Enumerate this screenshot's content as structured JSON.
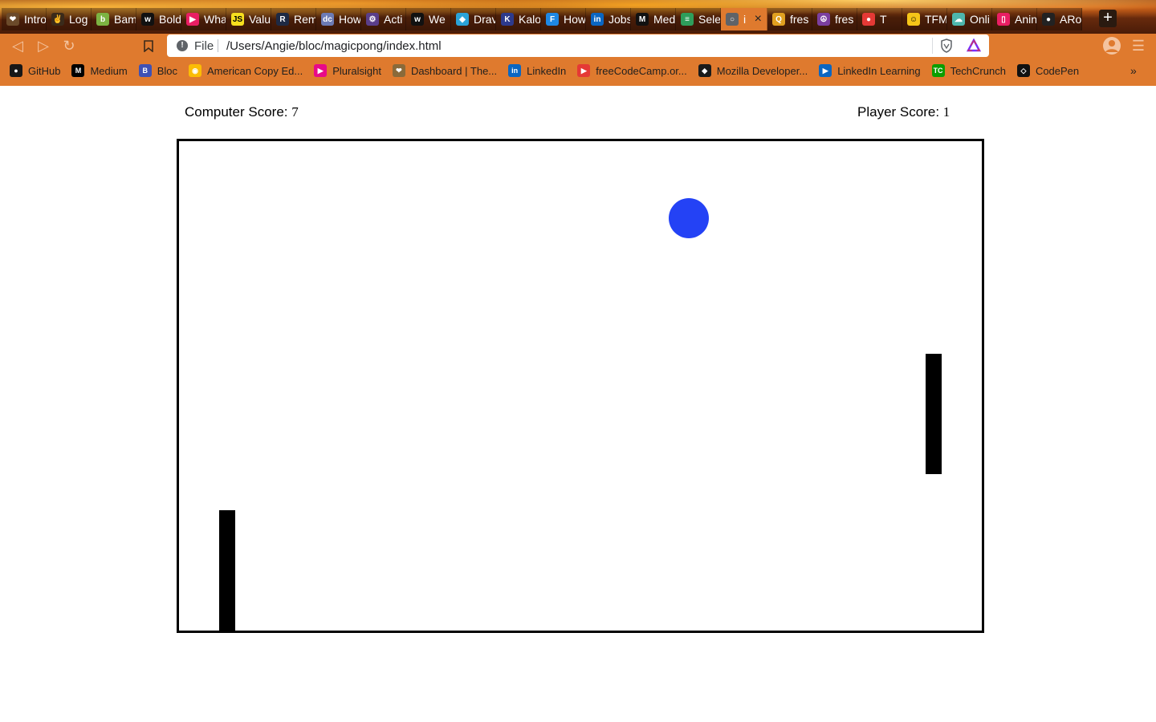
{
  "browser": {
    "tabs": [
      {
        "title": "Intro",
        "color": "#6b4a2a",
        "glyph": "❤"
      },
      {
        "title": "Log",
        "color": "#3a2a1a",
        "glyph": "✌"
      },
      {
        "title": "Bam",
        "color": "#7cb342",
        "glyph": "b"
      },
      {
        "title": "Bold",
        "color": "#111111",
        "glyph": "w"
      },
      {
        "title": "Wha",
        "color": "#e91e63",
        "glyph": "▶"
      },
      {
        "title": "Valu",
        "color": "#f7df1e",
        "glyph": "JS"
      },
      {
        "title": "Rem",
        "color": "#1e2a44",
        "glyph": "R"
      },
      {
        "title": "How",
        "color": "#6c7bb5",
        "glyph": "dc"
      },
      {
        "title": "Acti",
        "color": "#5a3e8a",
        "glyph": "⚙"
      },
      {
        "title": "We",
        "color": "#111111",
        "glyph": "w"
      },
      {
        "title": "Drav",
        "color": "#2aa3d8",
        "glyph": "◆"
      },
      {
        "title": "Kalo",
        "color": "#2d3a8c",
        "glyph": "K"
      },
      {
        "title": "How",
        "color": "#1e88e5",
        "glyph": "F"
      },
      {
        "title": "Jobs",
        "color": "#0a66c2",
        "glyph": "in"
      },
      {
        "title": "Med",
        "color": "#111111",
        "glyph": "M"
      },
      {
        "title": "Sele",
        "color": "#2e9e5b",
        "glyph": "≡"
      },
      {
        "title": "i",
        "color": "#5f6368",
        "glyph": "○"
      },
      {
        "title": "fres",
        "color": "#e0a020",
        "glyph": "Q"
      },
      {
        "title": "fres",
        "color": "#7b3fa0",
        "glyph": "☮"
      },
      {
        "title": "T",
        "color": "#e53935",
        "glyph": "●"
      },
      {
        "title": "TFM",
        "color": "#f5c518",
        "glyph": "☺"
      },
      {
        "title": "Onli",
        "color": "#4db6ac",
        "glyph": "☁"
      },
      {
        "title": "Anin",
        "color": "#e91e63",
        "glyph": "▯"
      },
      {
        "title": "ARo",
        "color": "#222222",
        "glyph": "●"
      }
    ],
    "active_tab_index": 16,
    "new_tab_label": "+",
    "url_scheme": "File",
    "url": "/Users/Angie/bloc/magicpong/index.html"
  },
  "bookmarks": [
    {
      "label": "GitHub",
      "color": "#181717",
      "glyph": "●"
    },
    {
      "label": "Medium",
      "color": "#000000",
      "glyph": "M"
    },
    {
      "label": "Bloc",
      "color": "#3f51b5",
      "glyph": "B"
    },
    {
      "label": "American Copy Ed...",
      "color": "#fbbc05",
      "glyph": "◉"
    },
    {
      "label": "Pluralsight",
      "color": "#e80a89",
      "glyph": "▶"
    },
    {
      "label": "Dashboard | The...",
      "color": "#8a6a3a",
      "glyph": "❤"
    },
    {
      "label": "LinkedIn",
      "color": "#0a66c2",
      "glyph": "in"
    },
    {
      "label": "freeCodeCamp.or...",
      "color": "#e53935",
      "glyph": "▶"
    },
    {
      "label": "Mozilla Developer...",
      "color": "#1a1a1a",
      "glyph": "◆"
    },
    {
      "label": "LinkedIn Learning",
      "color": "#0a66c2",
      "glyph": "▶"
    },
    {
      "label": "TechCrunch",
      "color": "#0a9e01",
      "glyph": "TC"
    },
    {
      "label": "CodePen",
      "color": "#111111",
      "glyph": "◇"
    }
  ],
  "bookmarks_more": "»",
  "game": {
    "computer_score_label": "Computer Score: ",
    "computer_score": "7",
    "player_score_label": "Player Score: ",
    "player_score": "1",
    "ball_color": "#2442f5"
  }
}
